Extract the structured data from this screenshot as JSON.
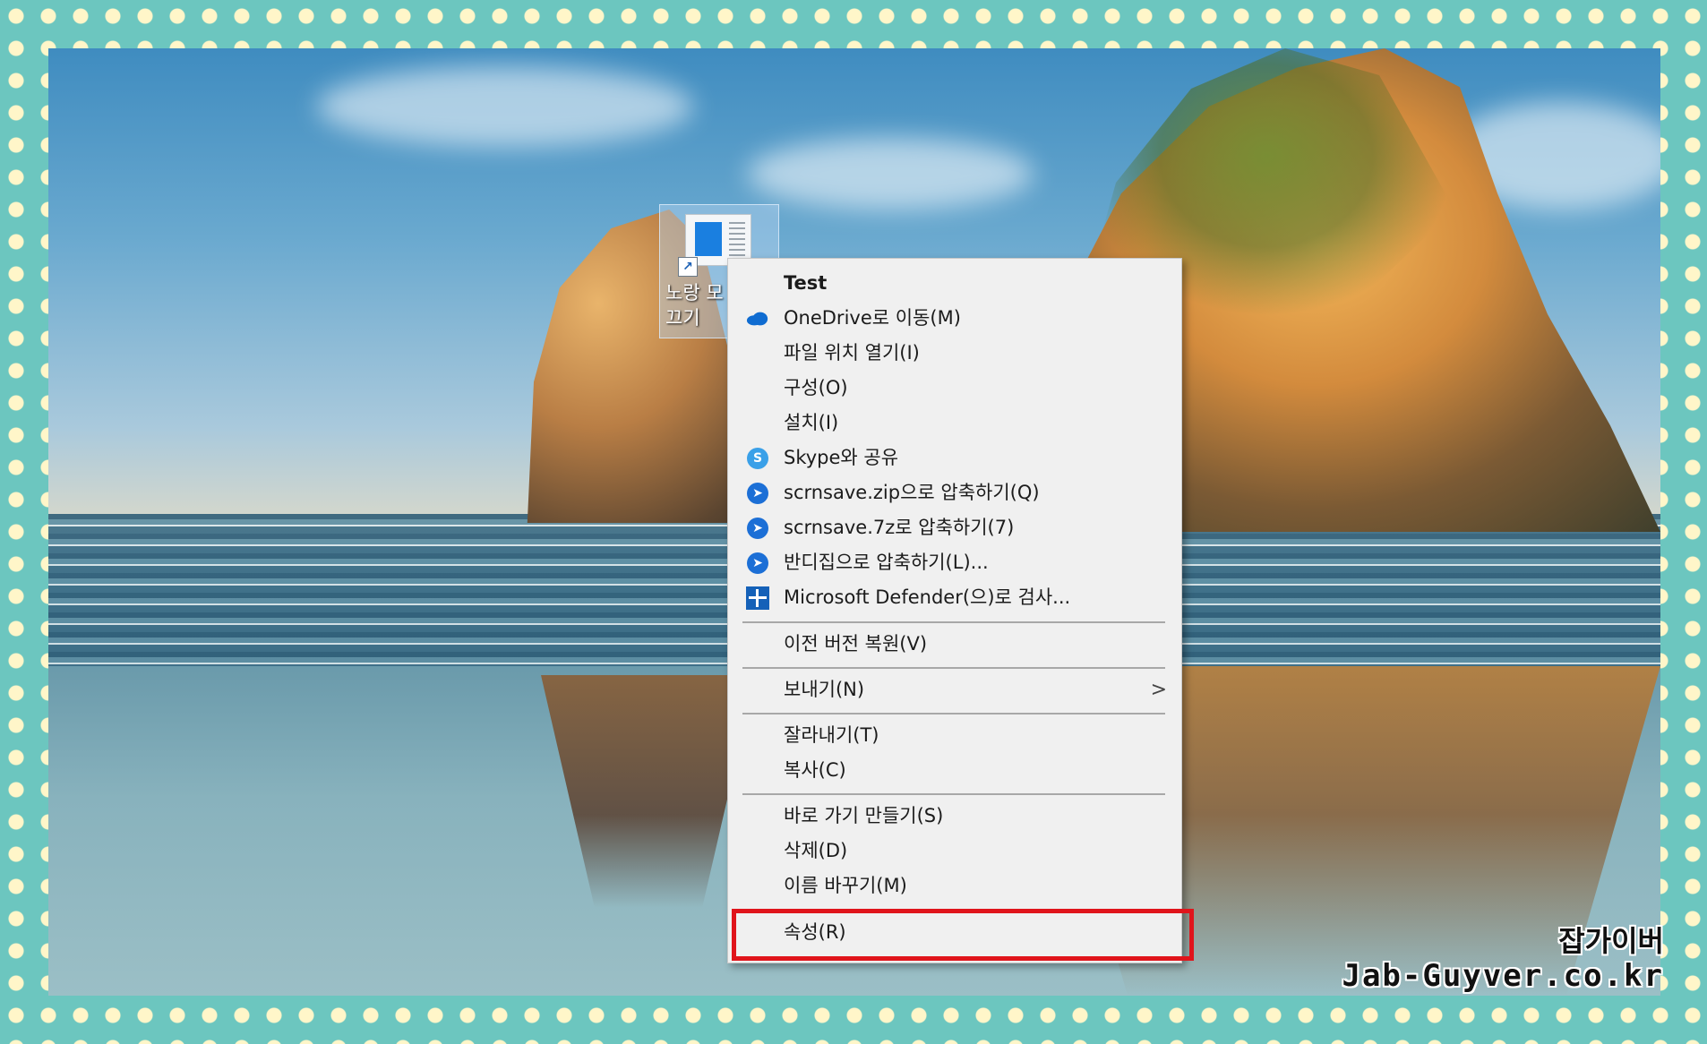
{
  "desktop_icon": {
    "label": "노랑 모\n끄기",
    "icon": "app-shortcut-icon"
  },
  "context_menu": {
    "items": [
      {
        "label": "Test",
        "bold": true,
        "icon": ""
      },
      {
        "label": "OneDrive로 이동(M)",
        "icon": "onedrive-cloud-icon"
      },
      {
        "label": "파일 위치 열기(I)",
        "icon": ""
      },
      {
        "label": "구성(O)",
        "icon": ""
      },
      {
        "label": "설치(I)",
        "icon": ""
      },
      {
        "label": "Skype와 공유",
        "icon": "skype-icon"
      },
      {
        "label": "scrnsave.zip으로 압축하기(Q)",
        "icon": "bandizip-icon"
      },
      {
        "label": "scrnsave.7z로 압축하기(7)",
        "icon": "bandizip-icon"
      },
      {
        "label": "반디집으로 압축하기(L)...",
        "icon": "bandizip-icon"
      },
      {
        "label": "Microsoft Defender(으)로 검사...",
        "icon": "defender-shield-icon"
      },
      {
        "label": "이전 버전 복원(V)",
        "icon": ""
      },
      {
        "label": "보내기(N)",
        "icon": "",
        "submenu": true
      },
      {
        "label": "잘라내기(T)",
        "icon": ""
      },
      {
        "label": "복사(C)",
        "icon": ""
      },
      {
        "label": "바로 가기 만들기(S)",
        "icon": ""
      },
      {
        "label": "삭제(D)",
        "icon": ""
      },
      {
        "label": "이름 바꾸기(M)",
        "icon": ""
      },
      {
        "label": "속성(R)",
        "icon": "",
        "highlighted": true
      }
    ],
    "submenu_glyph": ">"
  },
  "watermark": {
    "korean": "잡가이버",
    "url": "Jab-Guyver.co.kr"
  },
  "colors": {
    "highlight_border": "#e0141b",
    "menu_bg": "#f0f0f0",
    "frame_dots": "#fff6c9",
    "frame_bg": "#6cc6bf"
  }
}
